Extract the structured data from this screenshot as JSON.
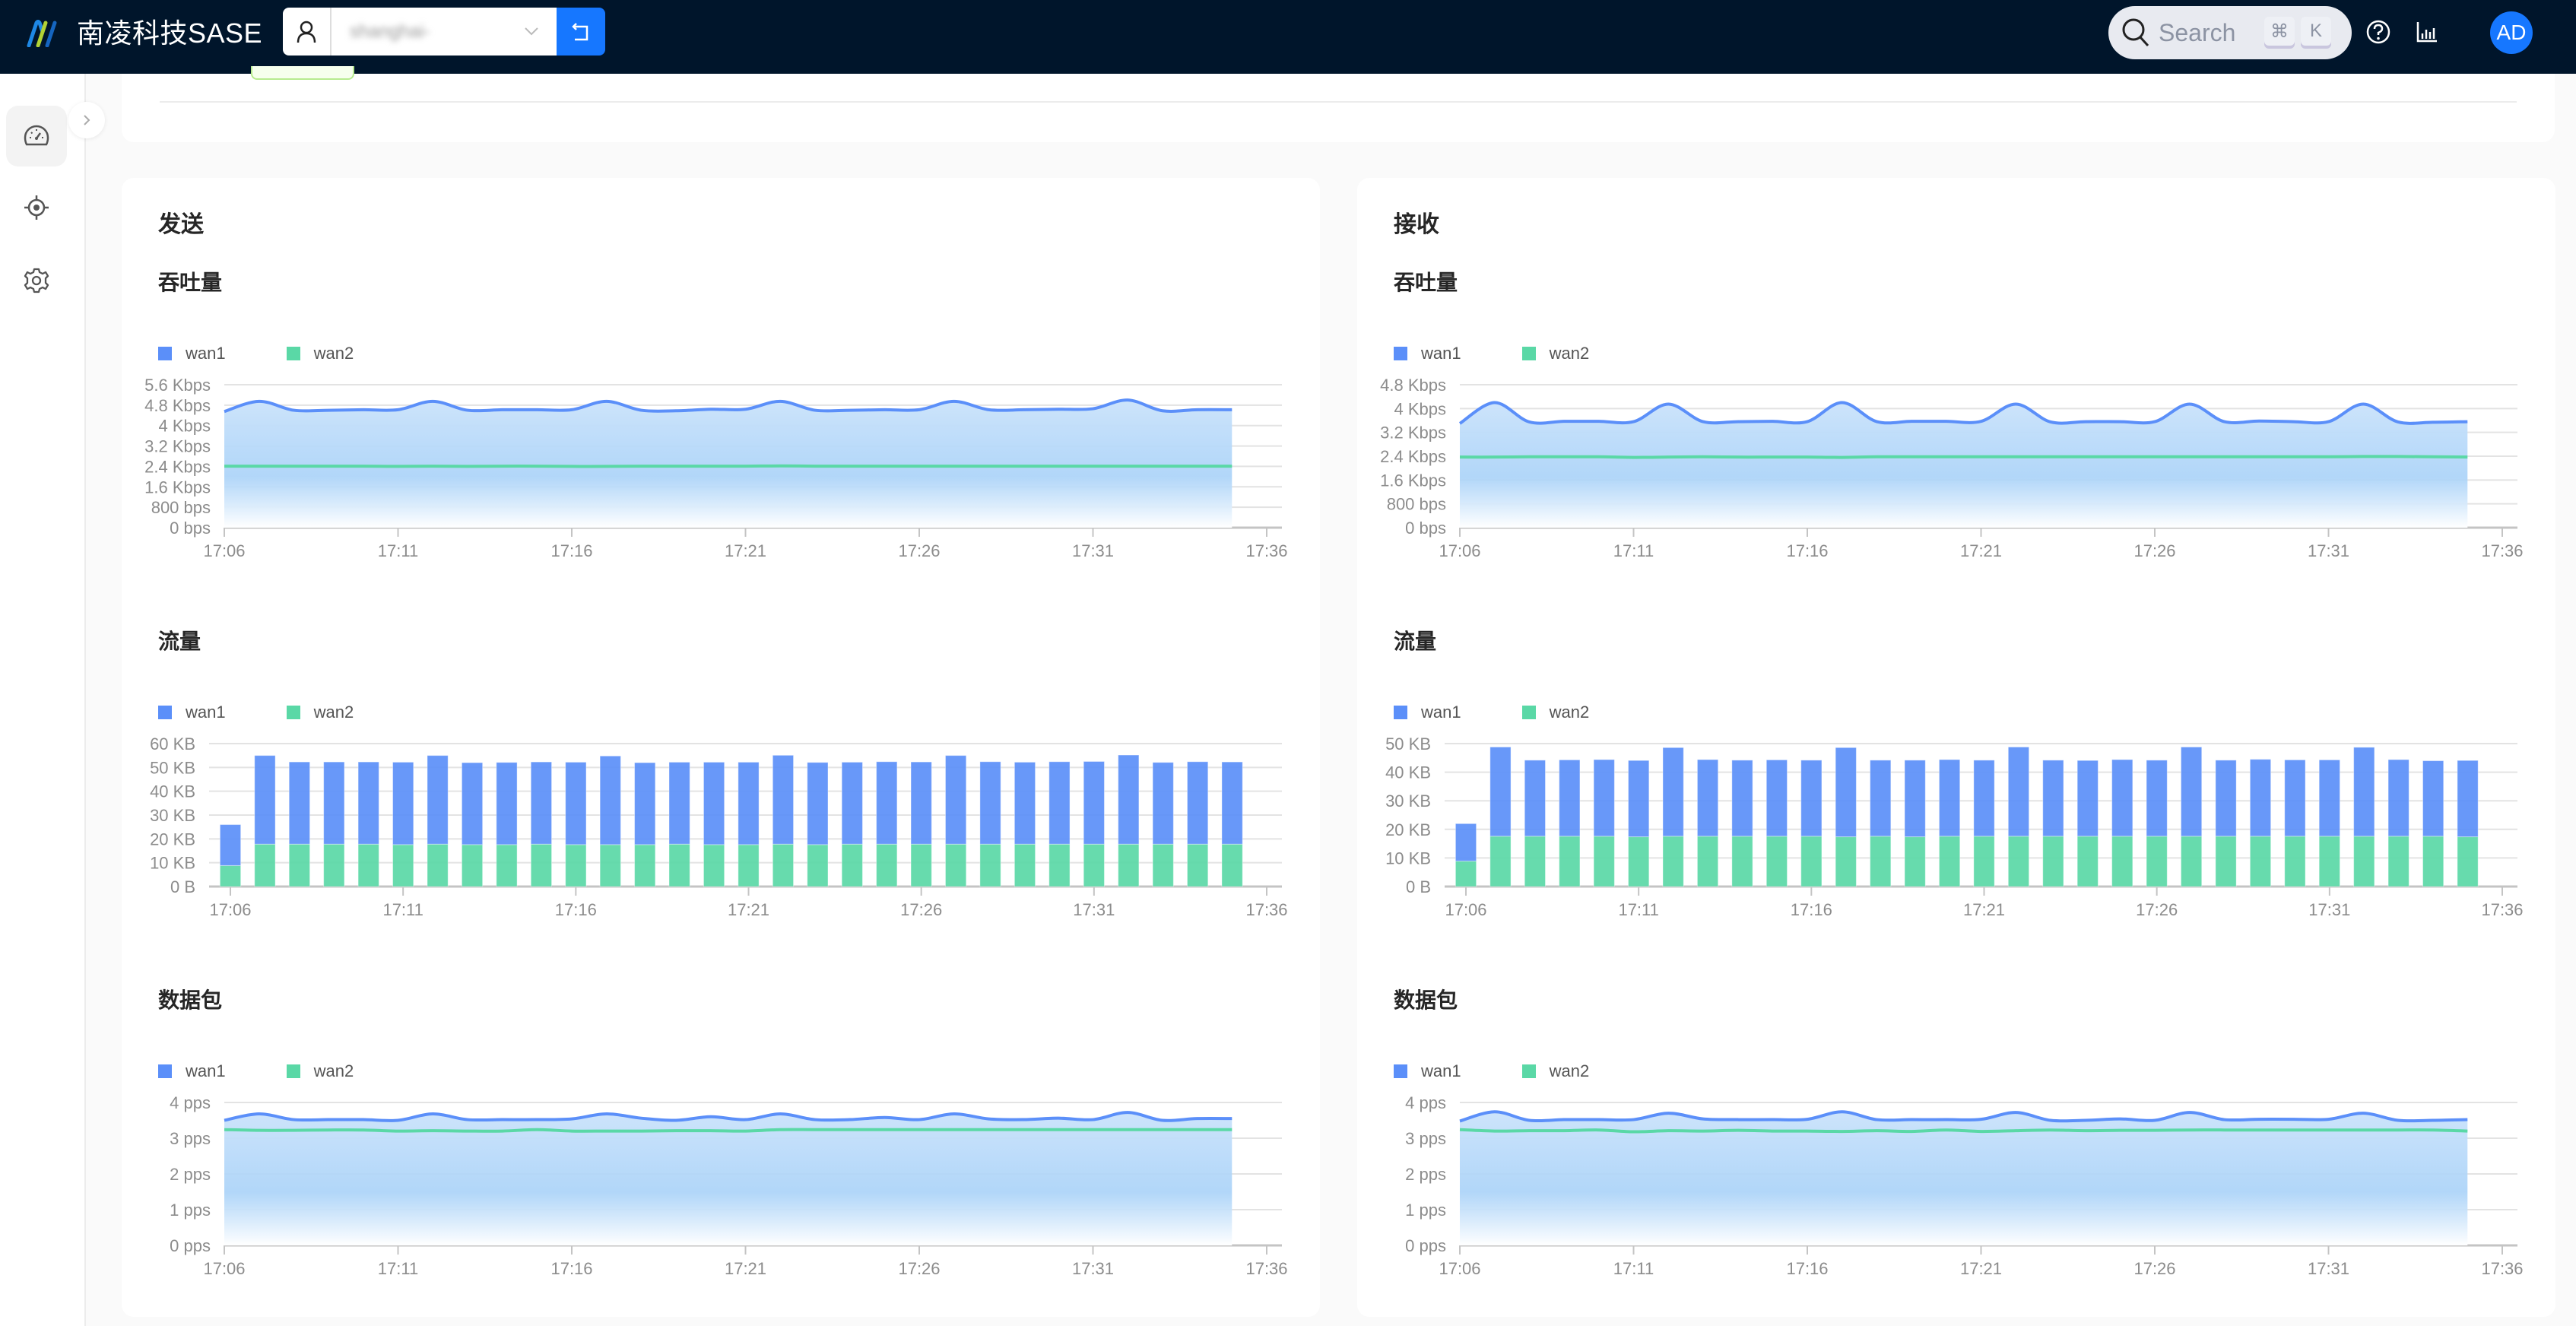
{
  "header": {
    "brand": "南凌科技SASE",
    "tenant_value": "shanghai-",
    "search_placeholder": "Search",
    "search_kbd": [
      "⌘",
      "K"
    ],
    "avatar_initials": "AD",
    "icons": [
      "user-icon",
      "chevron-down-icon",
      "switch-back-icon",
      "search-icon",
      "help-icon",
      "bar-chart-icon"
    ]
  },
  "sidebar": {
    "items": [
      {
        "name": "dashboard",
        "icon": "dashboard-icon",
        "active": true
      },
      {
        "name": "location",
        "icon": "target-icon",
        "active": false
      },
      {
        "name": "settings",
        "icon": "gear-icon",
        "active": false
      }
    ]
  },
  "colors": {
    "wan1": "#5b8ff9",
    "wan2": "#5ad8a6",
    "accent": "#1677ff",
    "header_bg": "#00152b"
  },
  "panels": [
    {
      "title": "发送",
      "key": "send"
    },
    {
      "title": "接收",
      "key": "recv"
    }
  ],
  "sections": {
    "throughput": "吞吐量",
    "traffic": "流量",
    "packets": "数据包"
  },
  "legend": [
    "wan1",
    "wan2"
  ],
  "chart_data": [
    {
      "id": "send-throughput",
      "panel": "发送",
      "title": "吞吐量",
      "type": "line",
      "x": [
        "17:06",
        "17:07",
        "17:08",
        "17:09",
        "17:10",
        "17:11",
        "17:12",
        "17:13",
        "17:14",
        "17:15",
        "17:16",
        "17:17",
        "17:18",
        "17:19",
        "17:20",
        "17:21",
        "17:22",
        "17:23",
        "17:24",
        "17:25",
        "17:26",
        "17:27",
        "17:28",
        "17:29",
        "17:30",
        "17:31",
        "17:32",
        "17:33",
        "17:34",
        "17:35"
      ],
      "xticks": [
        "17:06",
        "17:11",
        "17:16",
        "17:21",
        "17:26",
        "17:31",
        "17:36"
      ],
      "xlim": [
        "17:06",
        "17:36"
      ],
      "yticks": [
        "0 bps",
        "800 bps",
        "1.6 Kbps",
        "2.4 Kbps",
        "3.2 Kbps",
        "4 Kbps",
        "4.8 Kbps",
        "5.6 Kbps"
      ],
      "ylim": [
        0,
        5600
      ],
      "yunit": "bps",
      "area_on": "wan1",
      "series": [
        {
          "name": "wan1",
          "values": [
            4550,
            4950,
            4600,
            4600,
            4620,
            4620,
            4950,
            4600,
            4620,
            4620,
            4620,
            4950,
            4600,
            4580,
            4640,
            4640,
            4950,
            4600,
            4600,
            4620,
            4620,
            4950,
            4620,
            4620,
            4640,
            4660,
            5000,
            4580,
            4620,
            4620
          ]
        },
        {
          "name": "wan2",
          "values": [
            2410,
            2410,
            2410,
            2410,
            2410,
            2400,
            2410,
            2400,
            2410,
            2410,
            2400,
            2400,
            2410,
            2410,
            2410,
            2410,
            2420,
            2410,
            2410,
            2410,
            2410,
            2410,
            2410,
            2410,
            2410,
            2410,
            2410,
            2410,
            2410,
            2410
          ]
        }
      ]
    },
    {
      "id": "recv-throughput",
      "panel": "接收",
      "title": "吞吐量",
      "type": "line",
      "x": [
        "17:06",
        "17:07",
        "17:08",
        "17:09",
        "17:10",
        "17:11",
        "17:12",
        "17:13",
        "17:14",
        "17:15",
        "17:16",
        "17:17",
        "17:18",
        "17:19",
        "17:20",
        "17:21",
        "17:22",
        "17:23",
        "17:24",
        "17:25",
        "17:26",
        "17:27",
        "17:28",
        "17:29",
        "17:30",
        "17:31",
        "17:32",
        "17:33",
        "17:34",
        "17:35"
      ],
      "xticks": [
        "17:06",
        "17:11",
        "17:16",
        "17:21",
        "17:26",
        "17:31",
        "17:36"
      ],
      "xlim": [
        "17:06",
        "17:36"
      ],
      "yticks": [
        "0 bps",
        "800 bps",
        "1.6 Kbps",
        "2.4 Kbps",
        "3.2 Kbps",
        "4 Kbps",
        "4.8 Kbps"
      ],
      "ylim": [
        0,
        4800
      ],
      "yunit": "bps",
      "area_on": "wan1",
      "series": [
        {
          "name": "wan1",
          "values": [
            3500,
            4200,
            3550,
            3570,
            3570,
            3560,
            4150,
            3560,
            3560,
            3570,
            3560,
            4200,
            3560,
            3570,
            3570,
            3570,
            4150,
            3550,
            3560,
            3560,
            3560,
            4150,
            3560,
            3580,
            3560,
            3560,
            4150,
            3550,
            3540,
            3560
          ]
        },
        {
          "name": "wan2",
          "values": [
            2370,
            2370,
            2380,
            2380,
            2380,
            2360,
            2370,
            2380,
            2370,
            2370,
            2370,
            2360,
            2380,
            2380,
            2380,
            2380,
            2380,
            2380,
            2380,
            2380,
            2380,
            2380,
            2380,
            2380,
            2380,
            2380,
            2390,
            2390,
            2380,
            2370
          ]
        }
      ]
    },
    {
      "id": "send-traffic",
      "panel": "发送",
      "title": "流量",
      "type": "bar",
      "stacked": true,
      "categories": [
        "17:06",
        "17:07",
        "17:08",
        "17:09",
        "17:10",
        "17:11",
        "17:12",
        "17:13",
        "17:14",
        "17:15",
        "17:16",
        "17:17",
        "17:18",
        "17:19",
        "17:20",
        "17:21",
        "17:22",
        "17:23",
        "17:24",
        "17:25",
        "17:26",
        "17:27",
        "17:28",
        "17:29",
        "17:30",
        "17:31",
        "17:32",
        "17:33",
        "17:34",
        "17:35"
      ],
      "xticks": [
        "17:06",
        "17:11",
        "17:16",
        "17:21",
        "17:26",
        "17:31",
        "17:36"
      ],
      "xlim": [
        "17:06",
        "17:36"
      ],
      "yticks": [
        "0 B",
        "10 KB",
        "20 KB",
        "30 KB",
        "40 KB",
        "50 KB",
        "60 KB"
      ],
      "ylim": [
        0,
        60
      ],
      "yunit": "KB",
      "series": [
        {
          "name": "wan2",
          "values": [
            8.8,
            17.8,
            17.8,
            17.8,
            17.8,
            17.6,
            17.8,
            17.6,
            17.6,
            17.8,
            17.6,
            17.6,
            17.6,
            17.8,
            17.6,
            17.6,
            17.8,
            17.6,
            17.8,
            17.8,
            17.8,
            17.8,
            17.8,
            17.8,
            17.8,
            17.8,
            17.8,
            17.8,
            17.8,
            17.8
          ]
        },
        {
          "name": "wan1",
          "values": [
            17.2,
            37.2,
            34.5,
            34.5,
            34.5,
            34.6,
            37.2,
            34.4,
            34.5,
            34.5,
            34.6,
            37.2,
            34.4,
            34.4,
            34.6,
            34.6,
            37.3,
            34.5,
            34.4,
            34.6,
            34.5,
            37.2,
            34.6,
            34.4,
            34.6,
            34.7,
            37.4,
            34.3,
            34.6,
            34.5
          ]
        }
      ]
    },
    {
      "id": "recv-traffic",
      "panel": "接收",
      "title": "流量",
      "type": "bar",
      "stacked": true,
      "categories": [
        "17:06",
        "17:07",
        "17:08",
        "17:09",
        "17:10",
        "17:11",
        "17:12",
        "17:13",
        "17:14",
        "17:15",
        "17:16",
        "17:17",
        "17:18",
        "17:19",
        "17:20",
        "17:21",
        "17:22",
        "17:23",
        "17:24",
        "17:25",
        "17:26",
        "17:27",
        "17:28",
        "17:29",
        "17:30",
        "17:31",
        "17:32",
        "17:33",
        "17:34",
        "17:35"
      ],
      "xticks": [
        "17:06",
        "17:11",
        "17:16",
        "17:21",
        "17:26",
        "17:31",
        "17:36"
      ],
      "xlim": [
        "17:06",
        "17:36"
      ],
      "yticks": [
        "0 B",
        "10 KB",
        "20 KB",
        "30 KB",
        "40 KB",
        "50 KB"
      ],
      "ylim": [
        0,
        50
      ],
      "yunit": "KB",
      "series": [
        {
          "name": "wan2",
          "values": [
            8.9,
            17.6,
            17.6,
            17.6,
            17.6,
            17.4,
            17.6,
            17.6,
            17.6,
            17.6,
            17.6,
            17.4,
            17.6,
            17.4,
            17.6,
            17.6,
            17.6,
            17.6,
            17.6,
            17.6,
            17.6,
            17.6,
            17.6,
            17.6,
            17.6,
            17.6,
            17.6,
            17.6,
            17.6,
            17.4
          ]
        },
        {
          "name": "wan1",
          "values": [
            13.1,
            31.2,
            26.6,
            26.7,
            26.8,
            26.7,
            31.0,
            26.8,
            26.6,
            26.7,
            26.6,
            31.2,
            26.6,
            26.8,
            26.8,
            26.6,
            31.2,
            26.6,
            26.5,
            26.8,
            26.6,
            31.2,
            26.6,
            26.9,
            26.7,
            26.7,
            31.1,
            26.8,
            26.4,
            26.7
          ]
        }
      ]
    },
    {
      "id": "send-packets",
      "panel": "发送",
      "title": "数据包",
      "type": "line",
      "x": [
        "17:06",
        "17:07",
        "17:08",
        "17:09",
        "17:10",
        "17:11",
        "17:12",
        "17:13",
        "17:14",
        "17:15",
        "17:16",
        "17:17",
        "17:18",
        "17:19",
        "17:20",
        "17:21",
        "17:22",
        "17:23",
        "17:24",
        "17:25",
        "17:26",
        "17:27",
        "17:28",
        "17:29",
        "17:30",
        "17:31",
        "17:32",
        "17:33",
        "17:34",
        "17:35"
      ],
      "xticks": [
        "17:06",
        "17:11",
        "17:16",
        "17:21",
        "17:26",
        "17:31",
        "17:36"
      ],
      "xlim": [
        "17:06",
        "17:36"
      ],
      "yticks": [
        "0 pps",
        "1 pps",
        "2 pps",
        "3 pps",
        "4 pps"
      ],
      "ylim": [
        0,
        4
      ],
      "yunit": "pps",
      "area_on": "wan1",
      "series": [
        {
          "name": "wan1",
          "values": [
            3.5,
            3.68,
            3.52,
            3.52,
            3.52,
            3.5,
            3.68,
            3.52,
            3.52,
            3.52,
            3.54,
            3.68,
            3.56,
            3.5,
            3.6,
            3.52,
            3.68,
            3.52,
            3.52,
            3.58,
            3.52,
            3.68,
            3.54,
            3.52,
            3.56,
            3.52,
            3.72,
            3.5,
            3.55,
            3.55
          ]
        },
        {
          "name": "wan2",
          "values": [
            3.24,
            3.22,
            3.22,
            3.23,
            3.23,
            3.2,
            3.21,
            3.2,
            3.2,
            3.24,
            3.2,
            3.2,
            3.2,
            3.21,
            3.21,
            3.2,
            3.24,
            3.24,
            3.24,
            3.24,
            3.24,
            3.24,
            3.24,
            3.24,
            3.24,
            3.24,
            3.24,
            3.24,
            3.24,
            3.24
          ]
        }
      ]
    },
    {
      "id": "recv-packets",
      "panel": "接收",
      "title": "数据包",
      "type": "line",
      "x": [
        "17:06",
        "17:07",
        "17:08",
        "17:09",
        "17:10",
        "17:11",
        "17:12",
        "17:13",
        "17:14",
        "17:15",
        "17:16",
        "17:17",
        "17:18",
        "17:19",
        "17:20",
        "17:21",
        "17:22",
        "17:23",
        "17:24",
        "17:25",
        "17:26",
        "17:27",
        "17:28",
        "17:29",
        "17:30",
        "17:31",
        "17:32",
        "17:33",
        "17:34",
        "17:35"
      ],
      "xticks": [
        "17:06",
        "17:11",
        "17:16",
        "17:21",
        "17:26",
        "17:31",
        "17:36"
      ],
      "xlim": [
        "17:06",
        "17:36"
      ],
      "yticks": [
        "0 pps",
        "1 pps",
        "2 pps",
        "3 pps",
        "4 pps"
      ],
      "ylim": [
        0,
        4
      ],
      "yunit": "pps",
      "area_on": "wan1",
      "series": [
        {
          "name": "wan1",
          "values": [
            3.48,
            3.74,
            3.5,
            3.52,
            3.52,
            3.52,
            3.7,
            3.54,
            3.52,
            3.52,
            3.53,
            3.74,
            3.52,
            3.52,
            3.52,
            3.53,
            3.72,
            3.5,
            3.5,
            3.54,
            3.5,
            3.72,
            3.52,
            3.53,
            3.53,
            3.53,
            3.7,
            3.5,
            3.5,
            3.52
          ]
        },
        {
          "name": "wan2",
          "values": [
            3.24,
            3.2,
            3.21,
            3.21,
            3.23,
            3.18,
            3.21,
            3.2,
            3.22,
            3.2,
            3.2,
            3.19,
            3.21,
            3.19,
            3.23,
            3.19,
            3.21,
            3.23,
            3.21,
            3.22,
            3.22,
            3.23,
            3.23,
            3.23,
            3.23,
            3.23,
            3.23,
            3.23,
            3.23,
            3.2
          ]
        }
      ]
    }
  ]
}
